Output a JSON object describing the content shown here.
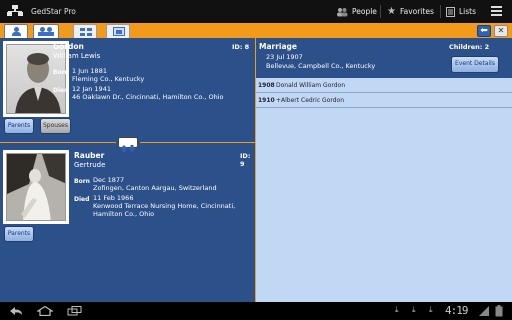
{
  "app": {
    "title": "GedStar Pro"
  },
  "actionbar": {
    "people_label": "People",
    "favorites_label": "Favorites",
    "lists_label": "Lists"
  },
  "person1": {
    "surname": "Gordon",
    "given": "William Lewis",
    "id": "ID: 8",
    "born_label": "Born",
    "born_date": "1 Jun 1881",
    "born_place": "Fleming Co., Kentucky",
    "died_label": "Died",
    "died_date": "12 Jan 1941",
    "died_place": "46 Oaklawn Dr., Cincinnati, Hamilton Co., Ohio",
    "parents_label": "Parents",
    "spouses_label": "Spouses"
  },
  "person2": {
    "surname": "Rauber",
    "given": "Gertrude",
    "id": "ID: 9",
    "born_label": "Born",
    "born_date": "Dec 1877",
    "born_place": "Zofingen, Canton Aargau, Switzerland",
    "died_label": "Died",
    "died_date": "11 Feb 1966",
    "died_place_1": "Kenwood Terrace Nursing Home, Cincinnati,",
    "died_place_2": "Hamilton Co., Ohio",
    "parents_label": "Parents"
  },
  "marriage": {
    "title": "Marriage",
    "children": "Children: 2",
    "date": "23 Jul 1907",
    "place": "Bellevue, Campbell Co., Kentucky",
    "event_button": "Event Details"
  },
  "children": [
    {
      "year": "1908",
      "name": "Donald William Gordon"
    },
    {
      "year": "1910",
      "name": "+Albert Cedric Gordon"
    }
  ],
  "system": {
    "clock": "4:19"
  },
  "colors": {
    "accent": "#f29a1a",
    "panel": "#2c518a",
    "list_bg": "#c0d8f4"
  }
}
